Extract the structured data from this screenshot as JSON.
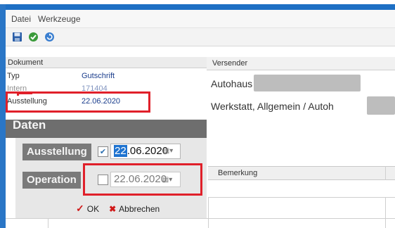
{
  "menu": {
    "items": [
      "Datei",
      "Werkzeuge"
    ]
  },
  "toolbar": {
    "buttons": [
      "save-icon",
      "check-icon",
      "refresh-icon"
    ]
  },
  "document_section": {
    "title": "Dokument",
    "fields": [
      {
        "label": "Typ",
        "value": "Gutschrift"
      },
      {
        "label": "Intern",
        "value": "171404"
      },
      {
        "label": "Ausstellung",
        "value": "22.06.2020"
      }
    ]
  },
  "sender_section": {
    "title": "Versender",
    "lines": [
      "Autohaus",
      "Werkstatt,  Allgemein / Autoh"
    ]
  },
  "daten": {
    "title": "Daten"
  },
  "popup": {
    "ausstellung": {
      "label": "Ausstellung",
      "checked": true,
      "day": "22",
      "rest": ".06.2020"
    },
    "operation": {
      "label": "Operation",
      "checked": false,
      "value": "22.06.2020"
    },
    "ok_label": "OK",
    "cancel_label": "Abbrechen"
  },
  "grid": {
    "header": "Bemerkung"
  },
  "colors": {
    "accent": "#1e6fc4",
    "highlight": "#e0202a",
    "popup_label_bg": "#7a7a7a"
  }
}
